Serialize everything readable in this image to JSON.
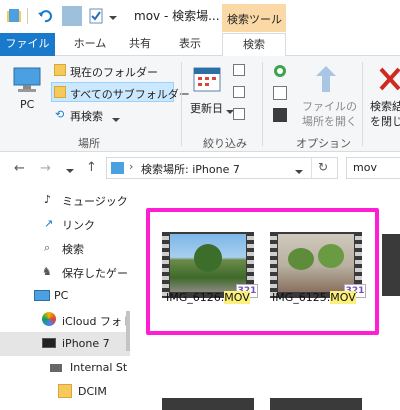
{
  "window": {
    "title": "mov - 検索場...",
    "context_tab": "検索ツール"
  },
  "ribbon_tabs": [
    "ファイル",
    "ホーム",
    "共有",
    "表示",
    "検索"
  ],
  "ribbon": {
    "location": {
      "pc_label": "PC",
      "current_folder": "現在のフォルダー",
      "all_subfolders": "すべてのサブフォルダー",
      "search_again": "再検索",
      "group_label": "場所"
    },
    "refine": {
      "date_modified": "更新日",
      "group_label": "絞り込み"
    },
    "options": {
      "open_file_location_line1": "ファイルの",
      "open_file_location_line2": "場所を開く",
      "group_label": "オプション"
    },
    "close": {
      "line1": "検索結",
      "line2": "を閉じ"
    }
  },
  "address": {
    "path": "検索場所: iPhone 7",
    "search_value": "mov"
  },
  "nav": {
    "items": [
      {
        "label": "ミュージック"
      },
      {
        "label": "リンク"
      },
      {
        "label": "検索"
      },
      {
        "label": "保存したゲー"
      },
      {
        "label": "PC"
      },
      {
        "label": "iCloud フォト"
      },
      {
        "label": "iPhone 7"
      },
      {
        "label": "Internal St"
      },
      {
        "label": "DCIM"
      }
    ]
  },
  "files": [
    {
      "name_prefix": "IMG_6126.",
      "name_match": "MOV",
      "badge": "321"
    },
    {
      "name_prefix": "IMG_6125.",
      "name_match": "MOV",
      "badge": "321"
    }
  ],
  "colors": {
    "accent": "#1979ca",
    "context_tab": "#fbd9a6",
    "selection_box": "#ff1ed4",
    "match_highlight": "#fbf07a",
    "selected_nav": "#cce8ff"
  }
}
